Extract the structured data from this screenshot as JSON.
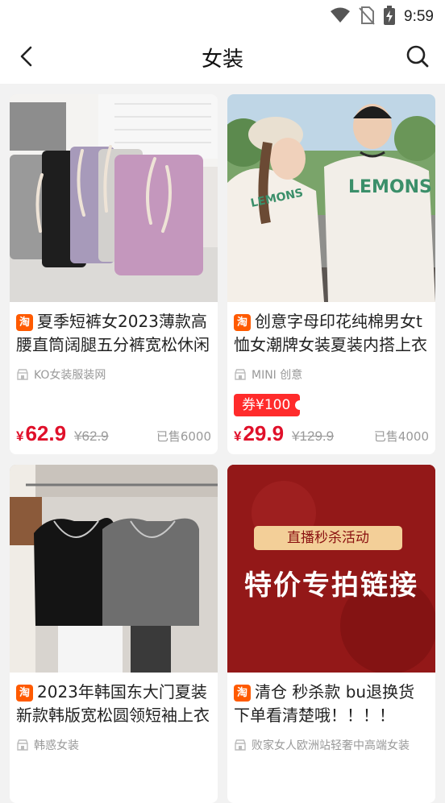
{
  "status_bar": {
    "time": "9:59",
    "icons": [
      "wifi-icon",
      "no-sim-icon",
      "battery-charging-icon"
    ]
  },
  "nav": {
    "title": "女装",
    "back_icon": "chevron-left-icon",
    "search_icon": "search-icon"
  },
  "products": [
    {
      "image": "shorts-photo",
      "badge": "淘",
      "title": "夏季短裤女2023薄款高腰直筒阔腿五分裤宽松休闲",
      "shop": "KO女装服装网",
      "coupon": "",
      "price_currency": "¥",
      "price": "62.9",
      "original_price": "¥62.9",
      "sold": "已售6000"
    },
    {
      "image": "couple-tshirt-photo",
      "badge": "淘",
      "title": "创意字母印花纯棉男女t恤女潮牌女装夏装内搭上衣",
      "shop": "MINI 创意",
      "coupon": "券¥100",
      "price_currency": "¥",
      "price": "29.9",
      "original_price": "¥129.9",
      "sold": "已售4000"
    },
    {
      "image": "tops-photo",
      "badge": "淘",
      "title": "2023年韩国东大门夏装新款韩版宽松圆领短袖上衣",
      "shop": "韩惑女装",
      "coupon": "",
      "price_currency": "",
      "price": "",
      "original_price": "",
      "sold": ""
    },
    {
      "image": "livestream-promo-banner",
      "banner_tag": "直播秒杀活动",
      "banner_text": "特价专拍链接",
      "badge": "淘",
      "title": "清仓 秒杀款 bu退换货下单看清楚哦！！！！",
      "shop": "败家女人欧洲站轻奢中高端女装",
      "coupon": "",
      "price_currency": "",
      "price": "",
      "original_price": "",
      "sold": ""
    }
  ],
  "colors": {
    "accent_red": "#e0102a",
    "coupon_red": "#ff2b2b",
    "taobao_orange": "#ff5a00",
    "banner_red": "#9d1a1a"
  }
}
